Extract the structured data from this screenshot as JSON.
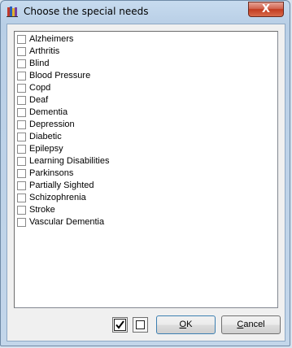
{
  "window": {
    "title": "Choose the special needs",
    "close_symbol": "X"
  },
  "list": {
    "items": [
      {
        "label": "Alzheimers",
        "checked": false
      },
      {
        "label": "Arthritis",
        "checked": false
      },
      {
        "label": "Blind",
        "checked": false
      },
      {
        "label": "Blood Pressure",
        "checked": false
      },
      {
        "label": "Copd",
        "checked": false
      },
      {
        "label": "Deaf",
        "checked": false
      },
      {
        "label": "Dementia",
        "checked": false
      },
      {
        "label": "Depression",
        "checked": false
      },
      {
        "label": "Diabetic",
        "checked": false
      },
      {
        "label": "Epilepsy",
        "checked": false
      },
      {
        "label": "Learning Disabilities",
        "checked": false
      },
      {
        "label": "Parkinsons",
        "checked": false
      },
      {
        "label": "Partially Sighted",
        "checked": false
      },
      {
        "label": "Schizophrenia",
        "checked": false
      },
      {
        "label": "Stroke",
        "checked": false
      },
      {
        "label": "Vascular Dementia",
        "checked": false
      }
    ]
  },
  "buttons": {
    "ok_mnemonic": "O",
    "ok_rest": "K",
    "cancel_mnemonic": "C",
    "cancel_rest": "ancel"
  },
  "icons": {
    "app": "books-icon",
    "check_all": "checkmark-icon",
    "uncheck_all": "empty-box-icon"
  }
}
